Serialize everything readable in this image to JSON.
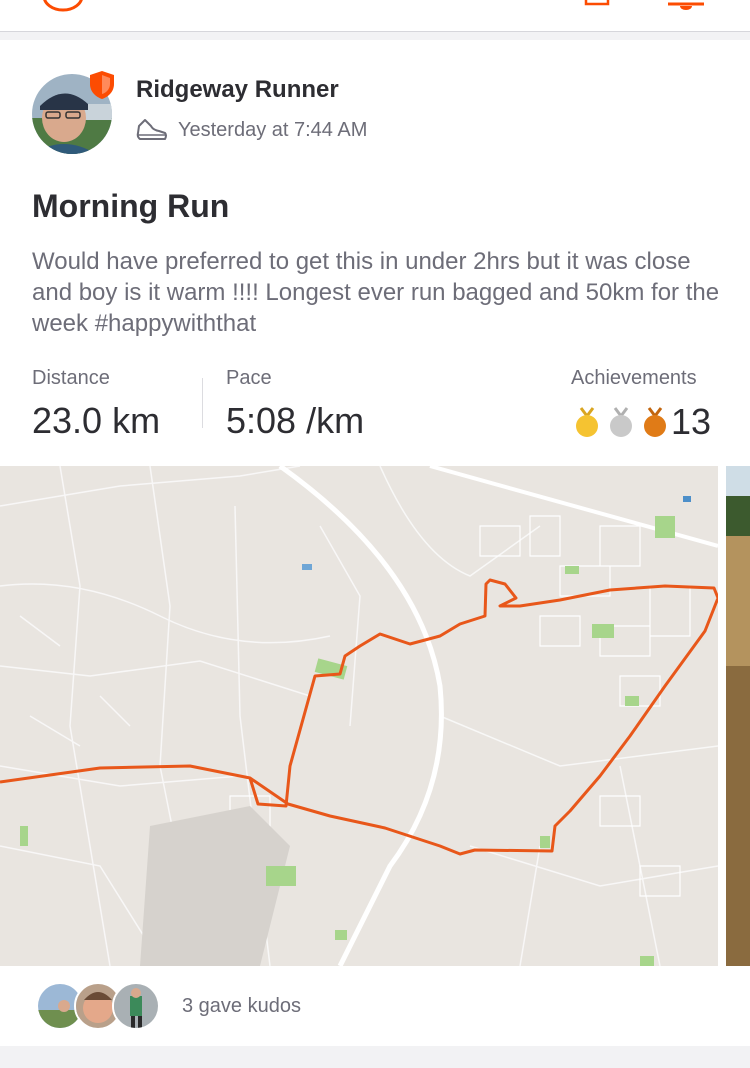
{
  "activity": {
    "athlete_name": "Ridgeway Runner",
    "timestamp": "Yesterday at 7:44 AM",
    "activity_type_icon": "running-shoe-icon",
    "title": "Morning Run",
    "description": "Would have preferred to get this in under 2hrs but it was close and boy is it warm !!!!  Longest ever run bagged and 50km for the week #happywiththat"
  },
  "stats": {
    "distance_label": "Distance",
    "distance_value": "23.0 km",
    "pace_label": "Pace",
    "pace_value": "5:08 /km",
    "achievements_label": "Achievements",
    "achievements_count": "13",
    "medals": [
      "gold-medal-icon",
      "silver-medal-icon",
      "bronze-medal-icon"
    ]
  },
  "kudos": {
    "text": "3 gave kudos",
    "avatar_count": 3
  },
  "colors": {
    "brand": "#fc4c02",
    "route": "#e8571a",
    "map_background": "#e9e5e0",
    "gold": "#f5c331",
    "silver": "#c9c9c9",
    "bronze": "#e07b17"
  }
}
